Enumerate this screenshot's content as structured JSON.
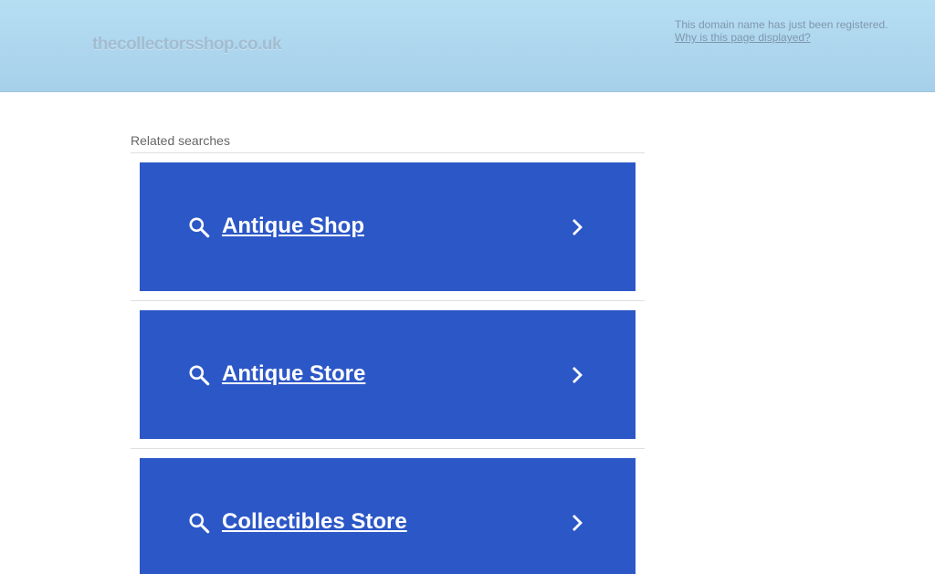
{
  "header": {
    "domain": "thecollectorsshop.co.uk",
    "notice_text": "This domain name has just been registered.",
    "notice_link": "Why is this page displayed?"
  },
  "main": {
    "related_label": "Related searches",
    "searches": [
      {
        "label": "Antique Shop",
        "search_icon": "search-icon",
        "chevron_icon": "chevron-right-icon"
      },
      {
        "label": "Antique Store",
        "search_icon": "search-icon",
        "chevron_icon": "chevron-right-icon"
      },
      {
        "label": "Collectibles Store",
        "search_icon": "search-icon",
        "chevron_icon": "chevron-right-icon"
      }
    ]
  },
  "colors": {
    "header_top": "#b6def3",
    "header_bottom": "#a6d0ea",
    "ad_background": "#2c57c7",
    "ad_text": "#ffffff",
    "domain_text": "#a3bcd0",
    "notice_text": "#7f97ad"
  }
}
